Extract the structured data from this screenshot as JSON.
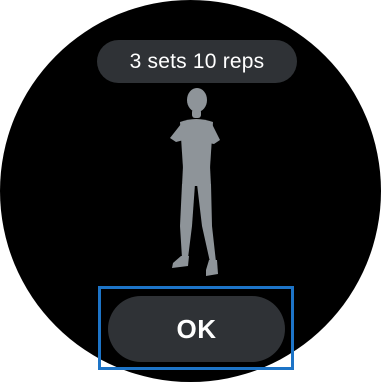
{
  "exercise": {
    "sets_reps": "3 sets 10 reps"
  },
  "actions": {
    "ok_label": "OK"
  },
  "illustration": {
    "icon": "standing-person-arms-crossed"
  },
  "colors": {
    "background": "#000000",
    "pill": "#2f3236",
    "figure": "#8e9499",
    "focus_outline": "#1d74c7",
    "text": "#ffffff"
  }
}
